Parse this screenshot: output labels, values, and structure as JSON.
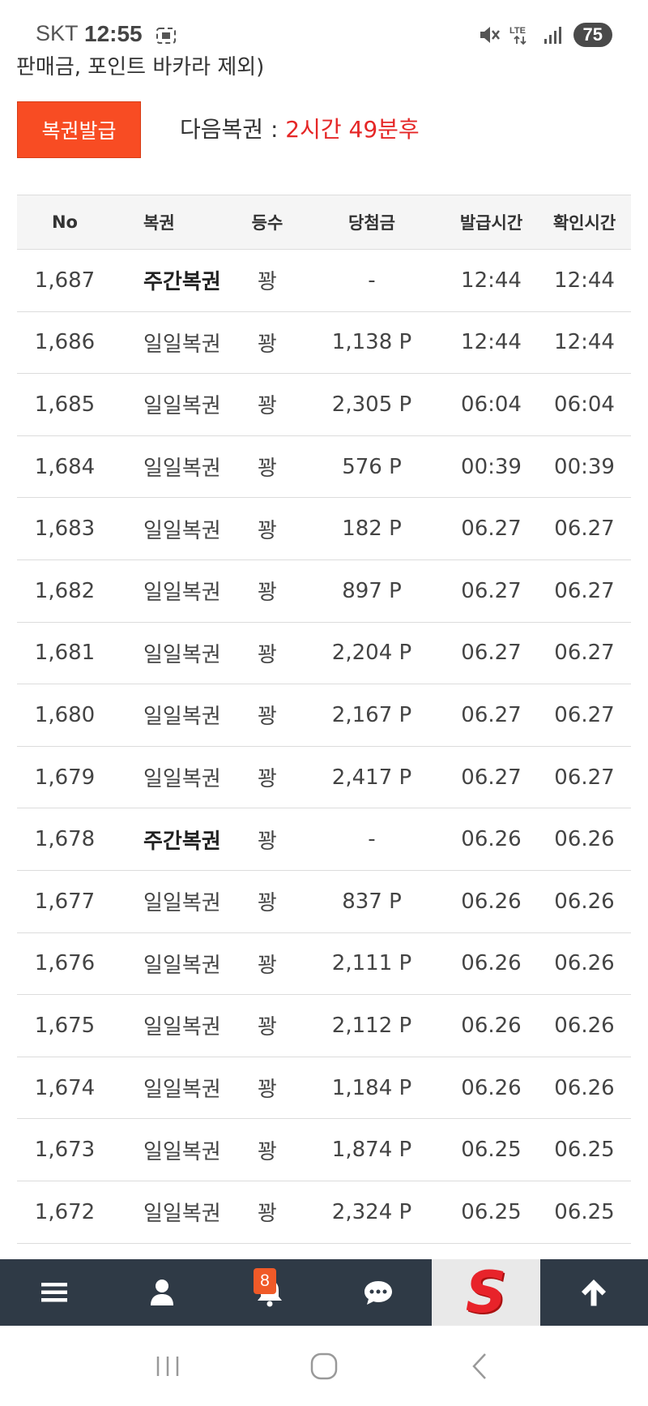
{
  "status_bar": {
    "carrier": "SKT",
    "time": "12:55",
    "network": "LTE",
    "battery": "75"
  },
  "cut_text": "판매금, 포인트 바카라 제외)",
  "issue": {
    "button_label": "복권발급",
    "next_label": "다음복권 : ",
    "countdown": "2시간 49분후"
  },
  "table": {
    "headers": {
      "no": "No",
      "type": "복권",
      "rank": "등수",
      "amount": "당첨금",
      "issued": "발급시간",
      "checked": "확인시간"
    },
    "rows": [
      {
        "no": "1,687",
        "type": "주간복권",
        "rank": "꽝",
        "amount": "-",
        "issued": "12:44",
        "checked": "12:44",
        "bold": true
      },
      {
        "no": "1,686",
        "type": "일일복권",
        "rank": "꽝",
        "amount": "1,138 P",
        "issued": "12:44",
        "checked": "12:44",
        "bold": false
      },
      {
        "no": "1,685",
        "type": "일일복권",
        "rank": "꽝",
        "amount": "2,305 P",
        "issued": "06:04",
        "checked": "06:04",
        "bold": false
      },
      {
        "no": "1,684",
        "type": "일일복권",
        "rank": "꽝",
        "amount": "576 P",
        "issued": "00:39",
        "checked": "00:39",
        "bold": false
      },
      {
        "no": "1,683",
        "type": "일일복권",
        "rank": "꽝",
        "amount": "182 P",
        "issued": "06.27",
        "checked": "06.27",
        "bold": false
      },
      {
        "no": "1,682",
        "type": "일일복권",
        "rank": "꽝",
        "amount": "897 P",
        "issued": "06.27",
        "checked": "06.27",
        "bold": false
      },
      {
        "no": "1,681",
        "type": "일일복권",
        "rank": "꽝",
        "amount": "2,204 P",
        "issued": "06.27",
        "checked": "06.27",
        "bold": false
      },
      {
        "no": "1,680",
        "type": "일일복권",
        "rank": "꽝",
        "amount": "2,167 P",
        "issued": "06.27",
        "checked": "06.27",
        "bold": false
      },
      {
        "no": "1,679",
        "type": "일일복권",
        "rank": "꽝",
        "amount": "2,417 P",
        "issued": "06.27",
        "checked": "06.27",
        "bold": false
      },
      {
        "no": "1,678",
        "type": "주간복권",
        "rank": "꽝",
        "amount": "-",
        "issued": "06.26",
        "checked": "06.26",
        "bold": true
      },
      {
        "no": "1,677",
        "type": "일일복권",
        "rank": "꽝",
        "amount": "837 P",
        "issued": "06.26",
        "checked": "06.26",
        "bold": false
      },
      {
        "no": "1,676",
        "type": "일일복권",
        "rank": "꽝",
        "amount": "2,111 P",
        "issued": "06.26",
        "checked": "06.26",
        "bold": false
      },
      {
        "no": "1,675",
        "type": "일일복권",
        "rank": "꽝",
        "amount": "2,112 P",
        "issued": "06.26",
        "checked": "06.26",
        "bold": false
      },
      {
        "no": "1,674",
        "type": "일일복권",
        "rank": "꽝",
        "amount": "1,184 P",
        "issued": "06.26",
        "checked": "06.26",
        "bold": false
      },
      {
        "no": "1,673",
        "type": "일일복권",
        "rank": "꽝",
        "amount": "1,874 P",
        "issued": "06.25",
        "checked": "06.25",
        "bold": false
      },
      {
        "no": "1,672",
        "type": "일일복권",
        "rank": "꽝",
        "amount": "2,324 P",
        "issued": "06.25",
        "checked": "06.25",
        "bold": false
      }
    ]
  },
  "bottom_nav": {
    "items": [
      {
        "icon": "menu-icon"
      },
      {
        "icon": "user-icon"
      },
      {
        "icon": "bell-icon"
      },
      {
        "icon": "chat-icon"
      },
      {
        "icon": "logo-s"
      },
      {
        "icon": "arrow-up-icon"
      }
    ],
    "notification_count": "8",
    "logo_letter": "S"
  },
  "colors": {
    "accent": "#f84c23",
    "countdown": "#e52727",
    "nav_bg": "#2f3a46"
  }
}
